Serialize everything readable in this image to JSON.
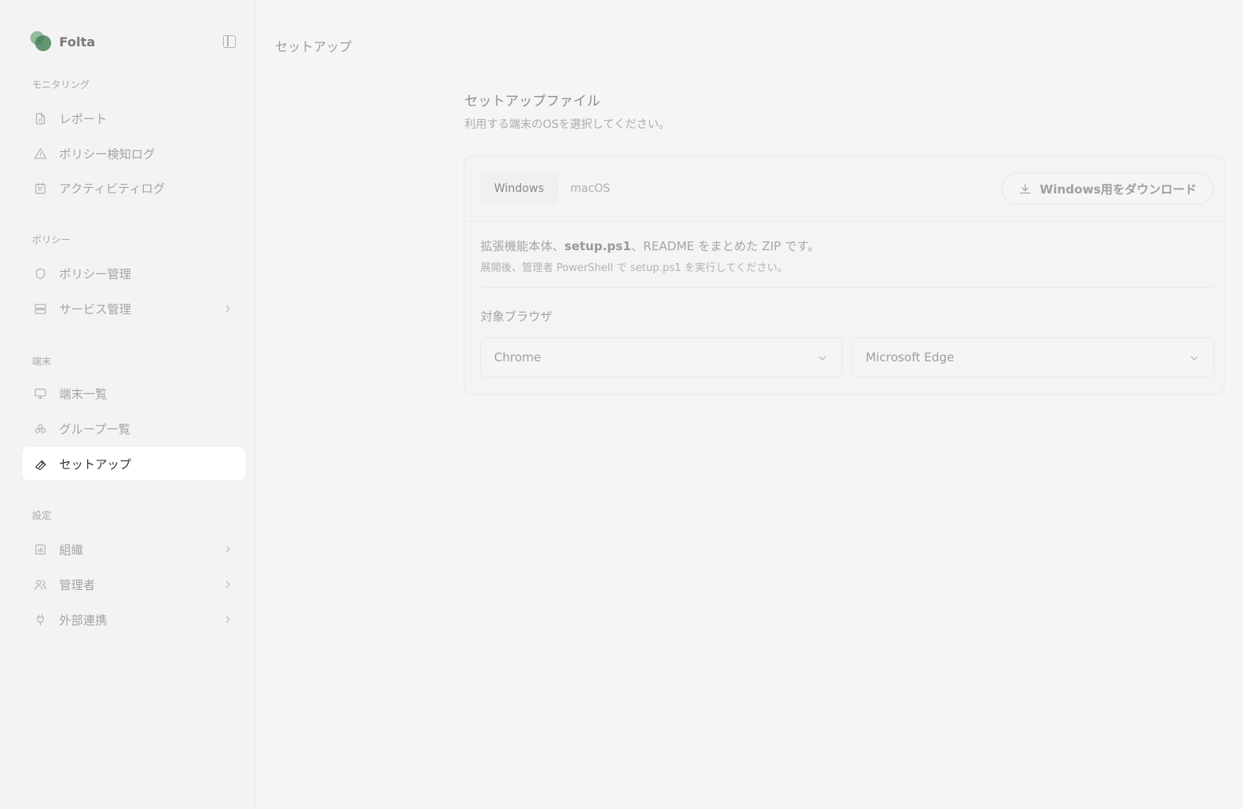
{
  "brand": {
    "name": "Folta"
  },
  "sidebar": {
    "sections": [
      {
        "label": "モニタリング",
        "items": [
          {
            "label": "レポート",
            "icon": "report-icon"
          },
          {
            "label": "ポリシー検知ログ",
            "icon": "warning-icon"
          },
          {
            "label": "アクティビティログ",
            "icon": "calendar-icon"
          }
        ]
      },
      {
        "label": "ポリシー",
        "items": [
          {
            "label": "ポリシー管理",
            "icon": "shield-icon"
          },
          {
            "label": "サービス管理",
            "icon": "server-icon"
          }
        ]
      },
      {
        "label": "端末",
        "items": [
          {
            "label": "端末一覧",
            "icon": "monitor-icon"
          },
          {
            "label": "グループ一覧",
            "icon": "group-icon"
          },
          {
            "label": "セットアップ",
            "icon": "wrench-icon"
          }
        ]
      },
      {
        "label": "設定",
        "items": [
          {
            "label": "組織",
            "icon": "building-icon"
          },
          {
            "label": "管理者",
            "icon": "users-icon"
          },
          {
            "label": "外部連携",
            "icon": "plug-icon"
          }
        ]
      }
    ]
  },
  "main": {
    "page_title": "セットアップ",
    "section_title": "セットアップファイル",
    "section_subtitle": "利用する端末のOSを選択してください。",
    "tabs": [
      {
        "label": "Windows"
      },
      {
        "label": "macOS"
      }
    ],
    "download_label": "Windows用をダウンロード",
    "description": {
      "prefix": "拡張機能本体、",
      "bold": "setup.ps1",
      "suffix": "、README をまとめた ZIP です。",
      "sub": "展開後、管理者 PowerShell で setup.ps1 を実行してください。"
    },
    "browser_label": "対象ブラウザ",
    "browser_selects": [
      {
        "value": "Chrome"
      },
      {
        "value": "Microsoft Edge"
      }
    ]
  }
}
